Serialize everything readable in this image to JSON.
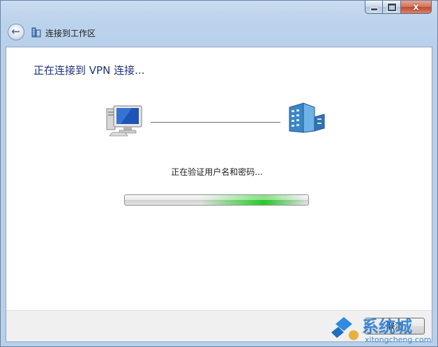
{
  "window": {
    "title": "连接到工作区",
    "caption": {
      "minimize_label": "",
      "maximize_label": "",
      "close_label": "x"
    }
  },
  "main": {
    "heading": "正在连接到 VPN 连接...",
    "status": "正在验证用户名和密码...",
    "progress": {
      "mode": "indeterminate"
    },
    "cancel_label": "取消"
  },
  "watermark": {
    "logo_text": "系统城",
    "url_text": "xitongcheng.com"
  },
  "colors": {
    "heading": "#1e3287",
    "progress_fill": "#3fd23f",
    "window_frame": "#b8d0ea"
  },
  "icons": {
    "back": "back-arrow-icon",
    "title": "workplace-network-icon",
    "client": "computer-icon",
    "server": "server-icon"
  }
}
